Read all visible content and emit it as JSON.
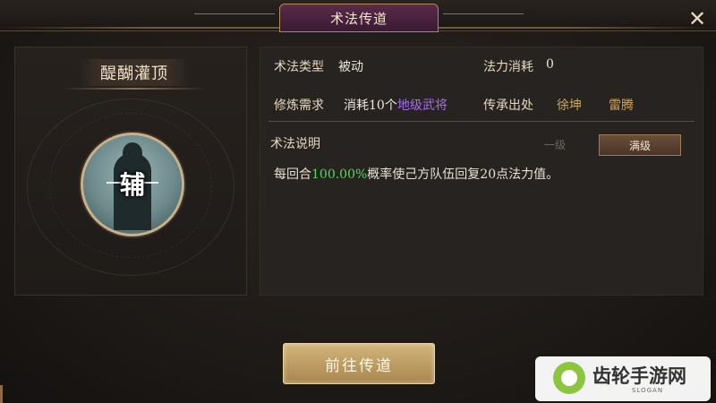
{
  "window": {
    "title": "术法传道",
    "close_icon": "close-icon"
  },
  "skill": {
    "name": "醍醐灌顶",
    "role_char": "辅",
    "icon": "strategist-portrait-icon"
  },
  "info": {
    "type_label": "术法类型",
    "type_value": "被动",
    "cost_label": "法力消耗",
    "cost_value": "0",
    "requirement_label": "修炼需求",
    "requirement_prefix": "消耗10个",
    "requirement_highlight": "地级武将",
    "source_label": "传承出处",
    "sources": [
      "徐坤",
      "雷腾"
    ]
  },
  "description": {
    "label": "术法说明",
    "level_tabs": [
      "一级",
      "满级"
    ],
    "selected_tab": "满级",
    "text_prefix": "每回合",
    "text_highlight": "100.00%",
    "text_suffix": "概率使己方队伍回复20点法力值。"
  },
  "actions": {
    "go_button": "前往传道"
  },
  "watermark": {
    "text": "齿轮手游网",
    "sub": "SLOGAN"
  },
  "colors": {
    "highlight_purple": "#a96bf0",
    "highlight_green": "#58d85a",
    "gold": "#c9a560"
  }
}
